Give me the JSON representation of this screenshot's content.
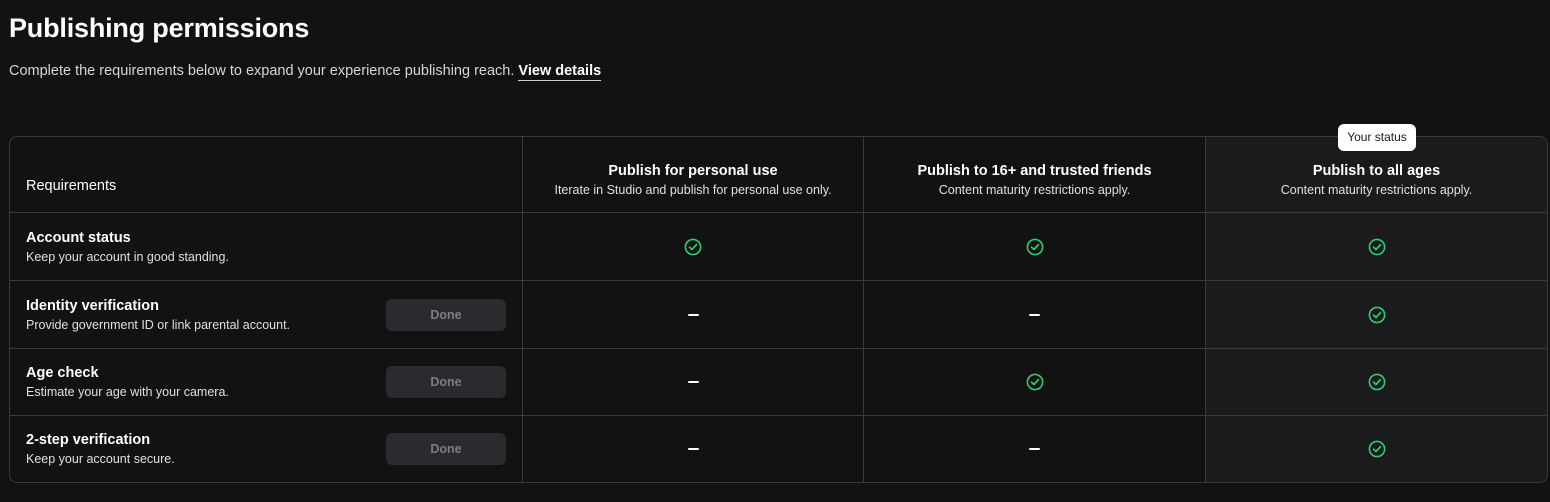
{
  "page": {
    "title": "Publishing permissions",
    "subtitle": "Complete the requirements below to expand your experience publishing reach.",
    "view_details_link": "View details"
  },
  "status_badge": "Your status",
  "table": {
    "requirements_header": "Requirements",
    "tiers": [
      {
        "title": "Publish for personal use",
        "description": "Iterate in Studio and publish for personal use only."
      },
      {
        "title": "Publish to 16+ and trusted friends",
        "description": "Content maturity restrictions apply."
      },
      {
        "title": "Publish to all ages",
        "description": "Content maturity restrictions apply."
      }
    ],
    "rows": [
      {
        "title": "Account status",
        "description": "Keep your account in good standing.",
        "button": null,
        "states": [
          "check",
          "check",
          "check"
        ]
      },
      {
        "title": "Identity verification",
        "description": "Provide government ID or link parental account.",
        "button": "Done",
        "states": [
          "dash",
          "dash",
          "check"
        ]
      },
      {
        "title": "Age check",
        "description": "Estimate your age with your camera.",
        "button": "Done",
        "states": [
          "dash",
          "check",
          "check"
        ]
      },
      {
        "title": "2-step verification",
        "description": "Keep your account secure.",
        "button": "Done",
        "states": [
          "dash",
          "dash",
          "check"
        ]
      }
    ]
  },
  "colors": {
    "background": "#121212",
    "check_green": "#2ecc71",
    "status_column_bg": "#1b1b1d"
  }
}
